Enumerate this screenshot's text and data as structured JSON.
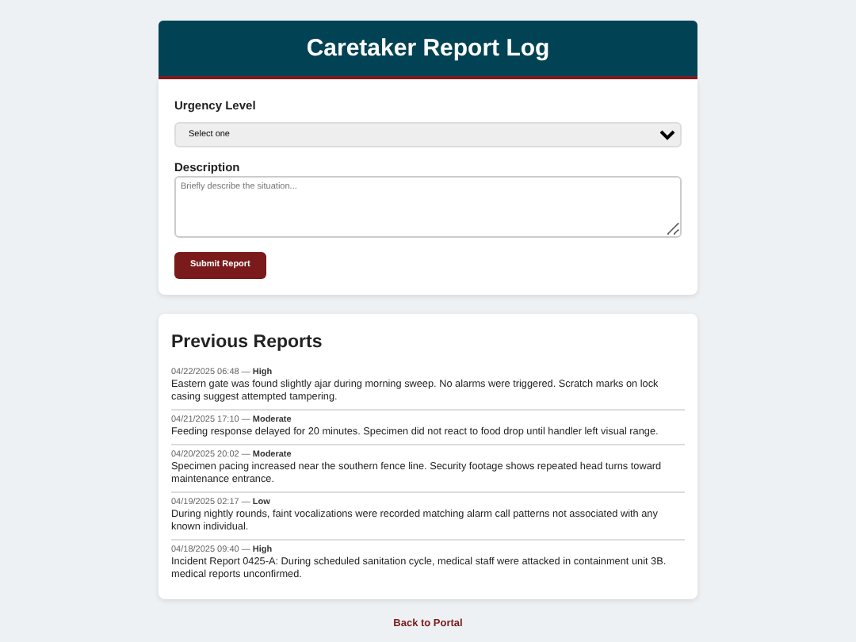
{
  "header": {
    "title": "Caretaker Report Log"
  },
  "form": {
    "urgency_label": "Urgency Level",
    "urgency_value": "Select one",
    "description_label": "Description",
    "description_placeholder": "Briefly describe the situation...",
    "submit": "Submit Report"
  },
  "reports_title": "Previous Reports",
  "reports": [
    {
      "meta": "04/22/2025 06:48 — **High**",
      "text": "Eastern gate was found slightly ajar during morning sweep. No alarms were triggered. Scratch marks on lock casing suggest attempted tampering."
    },
    {
      "meta": "04/21/2025 17:10 — **Moderate**",
      "text": "Feeding response delayed for 20 minutes. Specimen did not react to food drop until handler left visual range."
    },
    {
      "meta": "04/20/2025 20:02 — **Moderate**",
      "text": "Specimen pacing increased near the southern fence line. Security footage shows repeated head turns toward maintenance entrance."
    },
    {
      "meta": "04/19/2025 02:17 — **Low**",
      "text": "During nightly rounds, faint vocalizations were recorded matching alarm call patterns not associated with any known individual."
    },
    {
      "meta": "04/18/2025 09:40 — **High**",
      "text": "Incident Report 0425-A: During scheduled sanitation cycle, medical staff were attacked in containment unit 3B. medical reports unconfirmed."
    }
  ],
  "back_link": "Back to Portal"
}
